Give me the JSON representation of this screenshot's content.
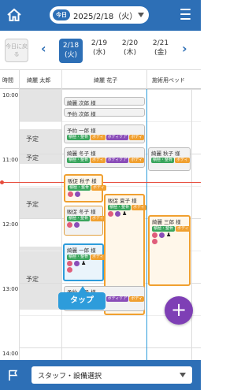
{
  "top": {
    "today_badge": "今日",
    "date": "2025/2/18（火）"
  },
  "daybar": {
    "today_button": "今日に戻る",
    "days": [
      {
        "date": "2/18",
        "dow": "(火)"
      },
      {
        "date": "2/19",
        "dow": "(水)"
      },
      {
        "date": "2/20",
        "dow": "(木)"
      },
      {
        "date": "2/21",
        "dow": "(金)"
      }
    ]
  },
  "columns": {
    "time": "時間",
    "staff1": "綺麗 太郎",
    "staff2": "綺麗 花子",
    "bed": "施術用ベッド"
  },
  "times": [
    "10:00",
    "11:00",
    "12:00",
    "13:00",
    "14:00"
  ],
  "yotei_label": "予定",
  "tags": {
    "g": "積極・整骨",
    "o": "ボディ",
    "p": "ボディケア"
  },
  "bookings": [
    {
      "name": "綺麗 次郎 様"
    },
    {
      "name": "予約 次郎 様"
    },
    {
      "name": "予約 一郎 様"
    },
    {
      "name": "綺麗 冬子 様"
    },
    {
      "name": "綺麗 秋子 様"
    },
    {
      "name": "販促 秋子 様"
    },
    {
      "name": "販促 冬子 様"
    },
    {
      "name": "販促 夏子 様"
    },
    {
      "name": "綺麗 一郎 様"
    },
    {
      "name": "綺麗 三郎 様"
    },
    {
      "name": "予約 冬子 様"
    }
  ],
  "tap_label": "タップ",
  "fab": "+",
  "bottom": {
    "staff_select": "スタッフ・設備選択"
  },
  "colors": {
    "primary": "#2d6fb6",
    "accent": "#7e3fb5",
    "tap": "#2d9cdb"
  }
}
